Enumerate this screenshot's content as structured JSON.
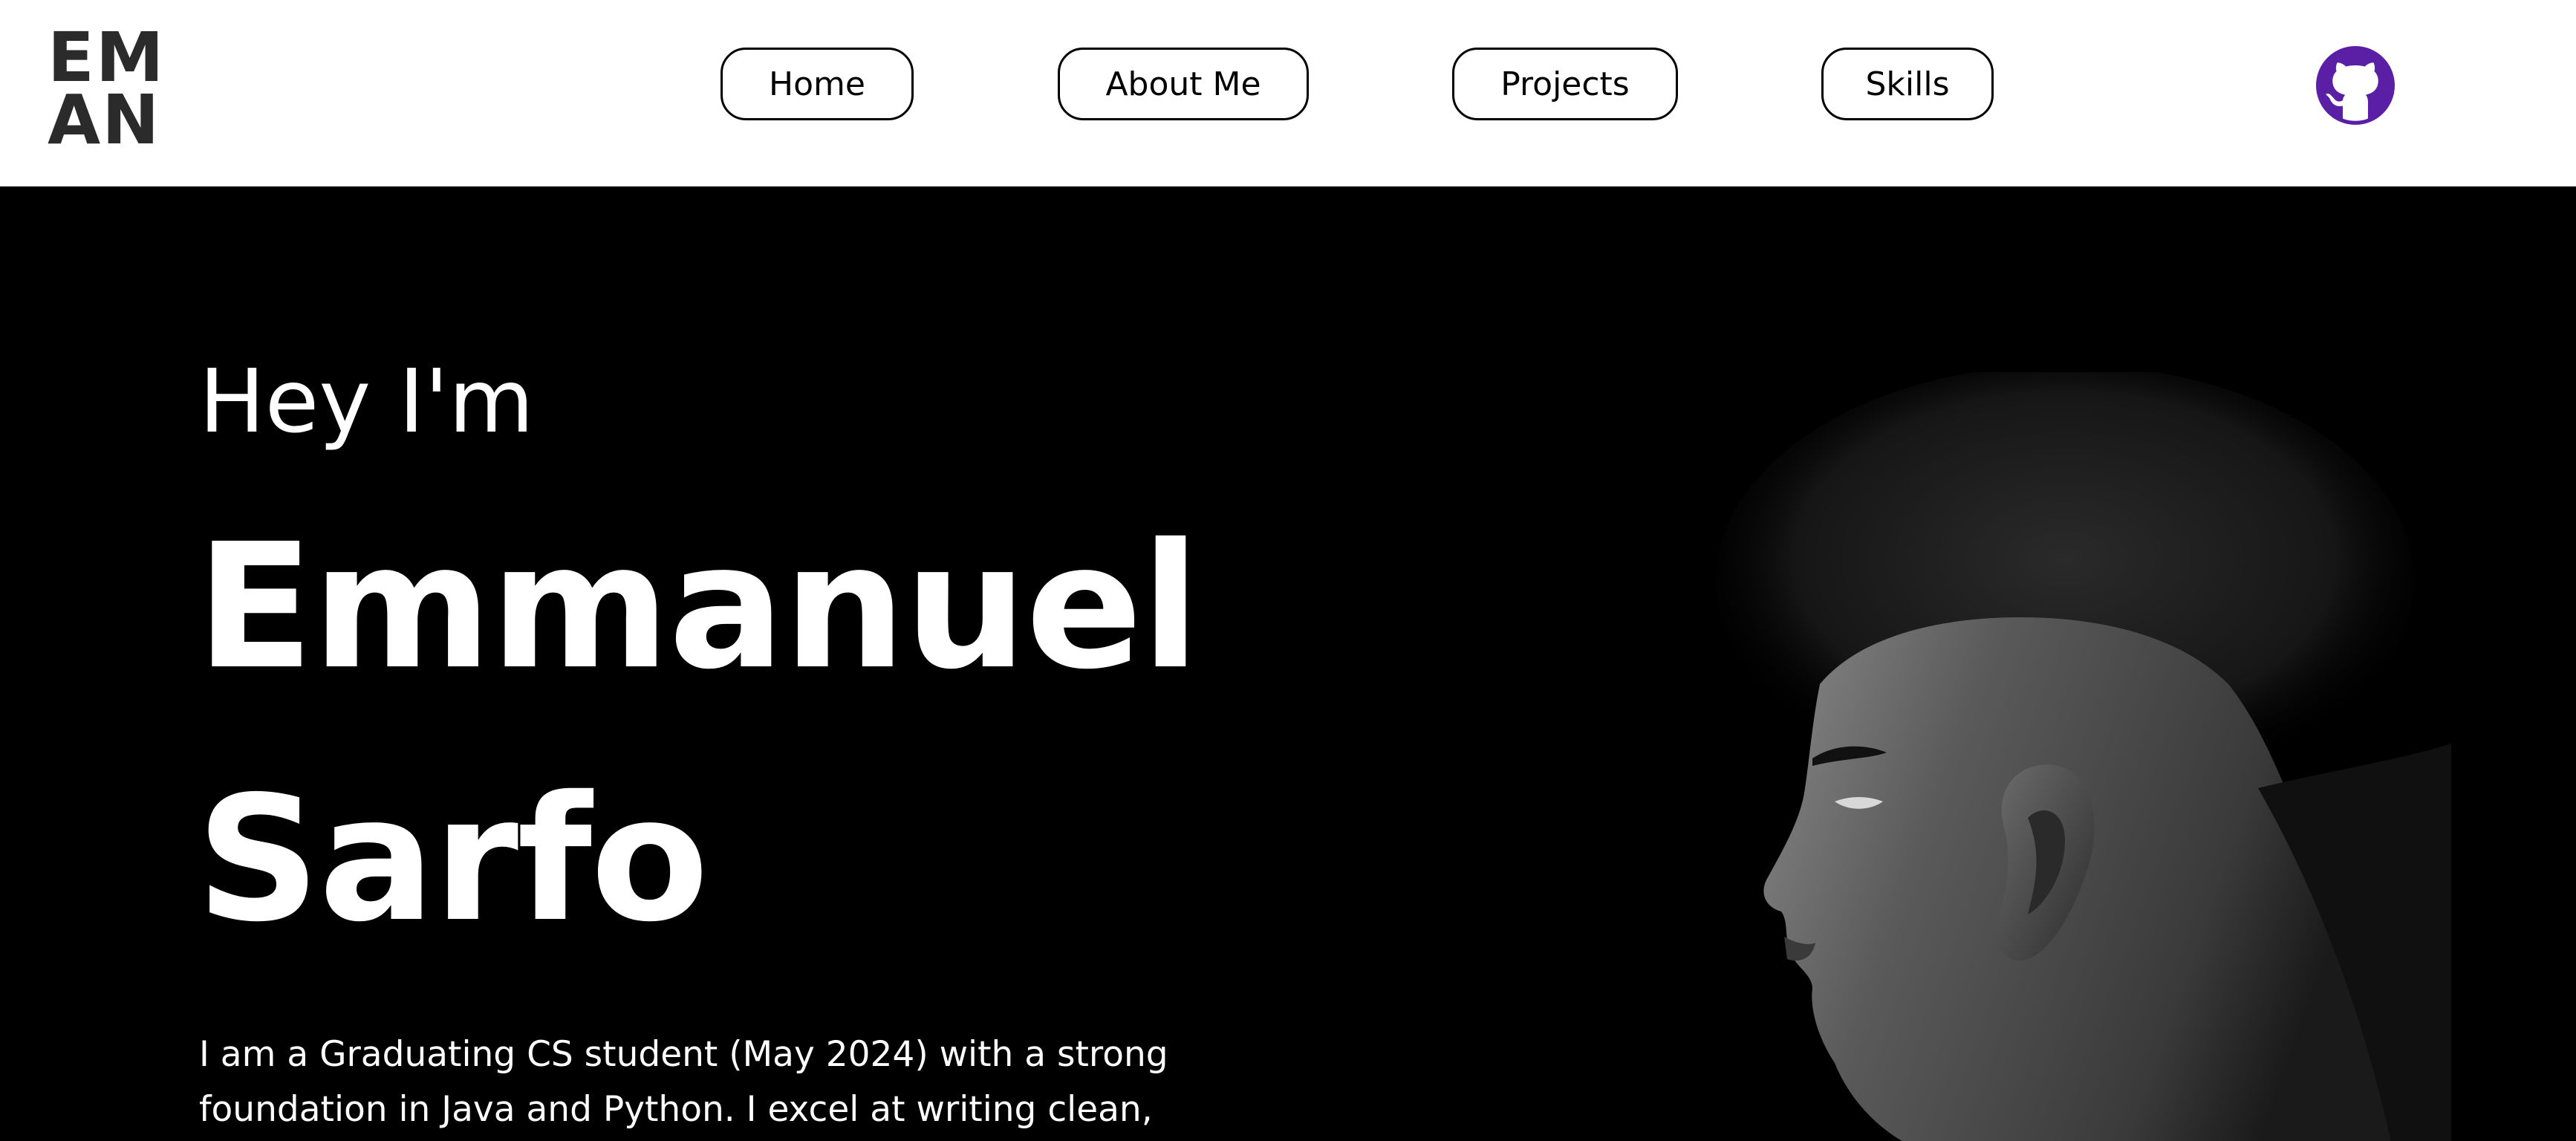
{
  "logo": {
    "line1": "EM",
    "line2": "AN"
  },
  "nav": {
    "items": [
      {
        "label": "Home"
      },
      {
        "label": "About Me"
      },
      {
        "label": "Projects"
      },
      {
        "label": "Skills"
      }
    ],
    "github_icon": "github-icon"
  },
  "colors": {
    "nav_bg": "#ffffff",
    "hero_bg": "#000000",
    "hero_text": "#ffffff",
    "github_accent": "#5b1fa6",
    "logo_text": "#2b2b2b"
  },
  "hero": {
    "greeting": "Hey I'm",
    "first_name": "Emmanuel",
    "last_name": "Sarfo",
    "bio": "I am a Graduating CS student (May 2024) with a strong foundation in Java and Python. I excel at writing clean,",
    "portrait": "profile-photo"
  }
}
